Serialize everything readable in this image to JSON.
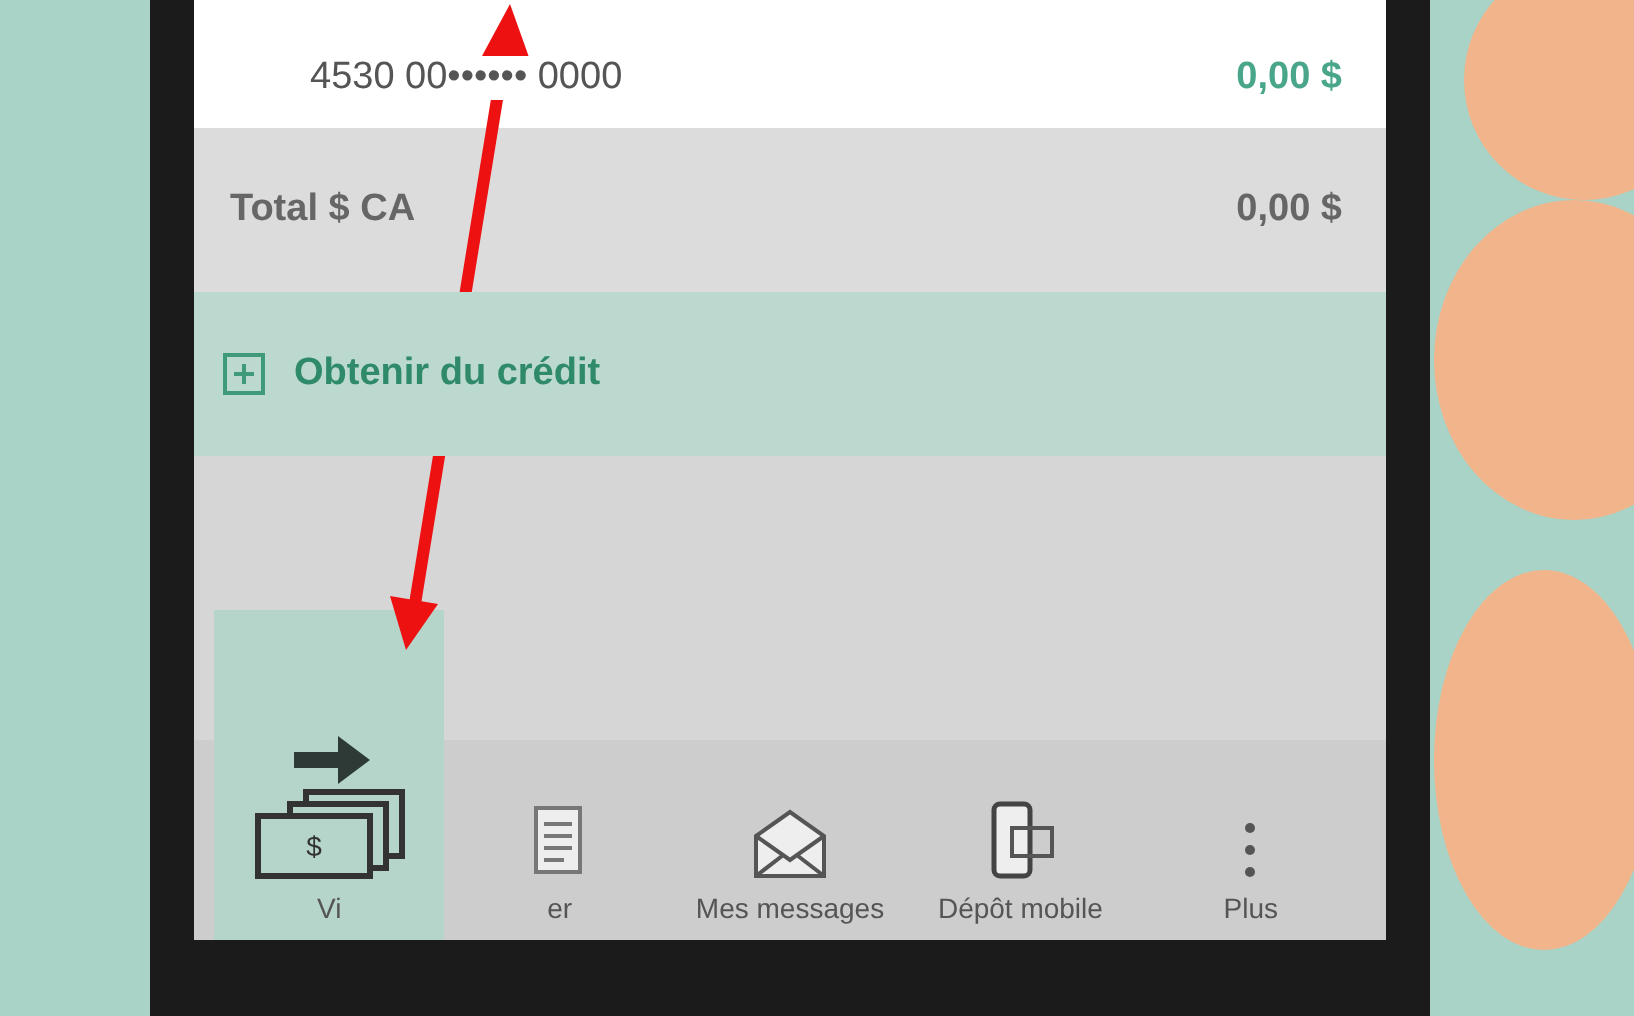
{
  "account_card": {
    "number": "4530 00•••••• 0000",
    "amount": "0,00 $"
  },
  "total": {
    "label": "Total $ CA",
    "amount": "0,00 $"
  },
  "credit_action": {
    "label": "Obtenir du crédit"
  },
  "nav_items": [
    {
      "kind": "transfer",
      "label": "Vi",
      "symbol": "$",
      "selected": true
    },
    {
      "kind": "bill",
      "label": "er",
      "selected": false
    },
    {
      "kind": "mail",
      "label": "Mes messages",
      "selected": false
    },
    {
      "kind": "deposit",
      "label": "Dépôt mobile",
      "selected": false
    },
    {
      "kind": "more",
      "label": "Plus",
      "selected": false
    }
  ]
}
